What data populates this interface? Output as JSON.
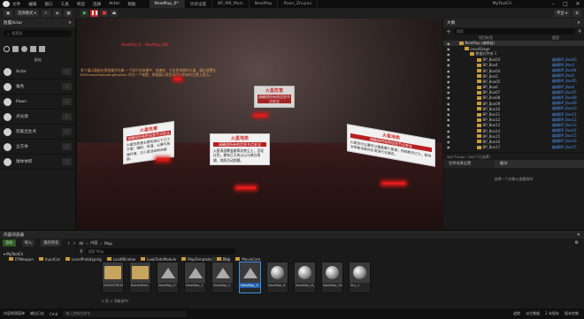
{
  "title_bar": {
    "menu": [
      "文件",
      "编辑",
      "窗口",
      "工具",
      "构造",
      "选择",
      "Actor",
      "帮助"
    ],
    "tabs": [
      "NewMap_0*",
      "项目设置",
      "BP_MB_Main",
      "NewMap",
      "Pawn_Zhuyan"
    ],
    "app_name": "MyToolCli"
  },
  "toolbar": {
    "mode_label": "选择模式",
    "play_label": "平台"
  },
  "place_actors": {
    "title": "放置Actor",
    "search_placeholder": "搜索类",
    "section": "基础",
    "categories": [
      "Actor",
      "角色",
      "Pawn",
      "点光源",
      "玩家出生点",
      "立方体",
      "球体体积"
    ]
  },
  "viewport": {
    "red_header": "NewMap_0 · NewMap_ND",
    "instructions": "多个展示面板在视觉看作为操 一个用于在场景中、快速的、大信息场景的大道、通过放置在BP/ScreenRoleadingPosition 作为一个装置，拼接展示类型采用在所有的位置上显示。",
    "signs": [
      {
        "title": "火星危害",
        "bar": "请确保所有的信息节点安全",
        "body": "火星的危害主要包括以下几个方面：辐射、低温、尘暴与极端环境，对人类活动构成威胁。"
      },
      {
        "title": "火星地表",
        "bar": "请确保所有的信息节点安全",
        "body": "火星表面覆盖着氧化铁尘土，呈现红色，拥有巨大的火山与峡谷地貌，地质活动频繁。"
      },
      {
        "title": "火星危害",
        "bar": "请确保所有的信息节点安全",
        "body": "火星的大气极为稀薄，表面受到强烈辐射，温度变化剧烈，对探测设备与人员都是挑战。"
      },
      {
        "title": "火星地表",
        "bar": "请确保所有的信息节点安全",
        "body": "火星的沙尘暴可以覆盖整个星球，持续数月之久，影响太阳能设备的正常运行与通讯。"
      }
    ]
  },
  "outliner": {
    "title": "大纲",
    "search_placeholder": "搜索",
    "col_label": "项目标签",
    "col_type": "类型",
    "items": [
      {
        "name": "NewMap (编辑器)",
        "type": ""
      },
      {
        "name": "LevelStage",
        "type": ""
      },
      {
        "name": "数据文件夹 1",
        "type": ""
      },
      {
        "name": "BP_Box03",
        "type": "编辑BP_Box03"
      },
      {
        "name": "BP_Box4",
        "type": "编辑BP_Box4"
      },
      {
        "name": "BP_Box04",
        "type": "编辑BP_Box04"
      },
      {
        "name": "BP_Box5",
        "type": "编辑BP_Box5"
      },
      {
        "name": "BP_Box05",
        "type": "编辑BP_Box05"
      },
      {
        "name": "BP_Box6",
        "type": "编辑BP_Box6"
      },
      {
        "name": "BP_Box07",
        "type": "编辑BP_Box07"
      },
      {
        "name": "BP_Box08",
        "type": "编辑BP_Box08"
      },
      {
        "name": "BP_Box09",
        "type": "编辑BP_Box09"
      },
      {
        "name": "BP_Box10",
        "type": "编辑BP_Box10"
      },
      {
        "name": "BP_Box11",
        "type": "编辑BP_Box11"
      },
      {
        "name": "BP_Box12",
        "type": "编辑BP_Box12"
      },
      {
        "name": "BP_Box13",
        "type": "编辑BP_Box13"
      },
      {
        "name": "BP_Box14",
        "type": "编辑BP_Box14"
      },
      {
        "name": "BP_Box15",
        "type": "编辑BP_Box15"
      },
      {
        "name": "BP_Box16",
        "type": "编辑BP_Box16"
      },
      {
        "name": "BP_Box17",
        "type": "编辑BP_Box17"
      }
    ],
    "footer": "462个Actor（462个已选择）"
  },
  "details": {
    "tab_world": "世界场景设置",
    "tab_details": "细节",
    "empty_text": "选择一个对象以查看细节"
  },
  "content_browser": {
    "title": "内容浏览器",
    "add_label": "添加",
    "import_label": "导入",
    "save_label": "保存所有",
    "path": [
      "All",
      "内容",
      "Map"
    ],
    "search_placeholder": "搜索 Map",
    "tree_root": "MyToolCli",
    "tree_items": [
      "FPWeapon",
      "InputCar",
      "LevelPrototyping",
      "LoadWindow",
      "LookTodoModule",
      "MapTemplate",
      "Map",
      "MovieCam"
    ],
    "assets": [
      {
        "name": "DATASTREAM",
        "kind": "folder"
      },
      {
        "name": "RoomMesh",
        "kind": "folder"
      },
      {
        "name": "NewMap_0",
        "kind": "map"
      },
      {
        "name": "NewMap_1",
        "kind": "map"
      },
      {
        "name": "NewMap_2",
        "kind": "map"
      },
      {
        "name": "NewMap_3",
        "kind": "map"
      },
      {
        "name": "NewMap_8",
        "kind": "sphere"
      },
      {
        "name": "NewMap_M_02",
        "kind": "sphere"
      },
      {
        "name": "NewMap_04",
        "kind": "sphere"
      },
      {
        "name": "Sky_1",
        "kind": "sphere"
      }
    ],
    "status": "9 项 (1 项被选中)"
  },
  "status_bar": {
    "drawer": "内容侧滑菜单",
    "output": "输出日志",
    "cmd": "Cmd",
    "cmd_placeholder": "输入控制台命令",
    "trace": "追踪",
    "derived": "派生数据",
    "unsaved": "2 未保存",
    "source": "版本控制"
  }
}
